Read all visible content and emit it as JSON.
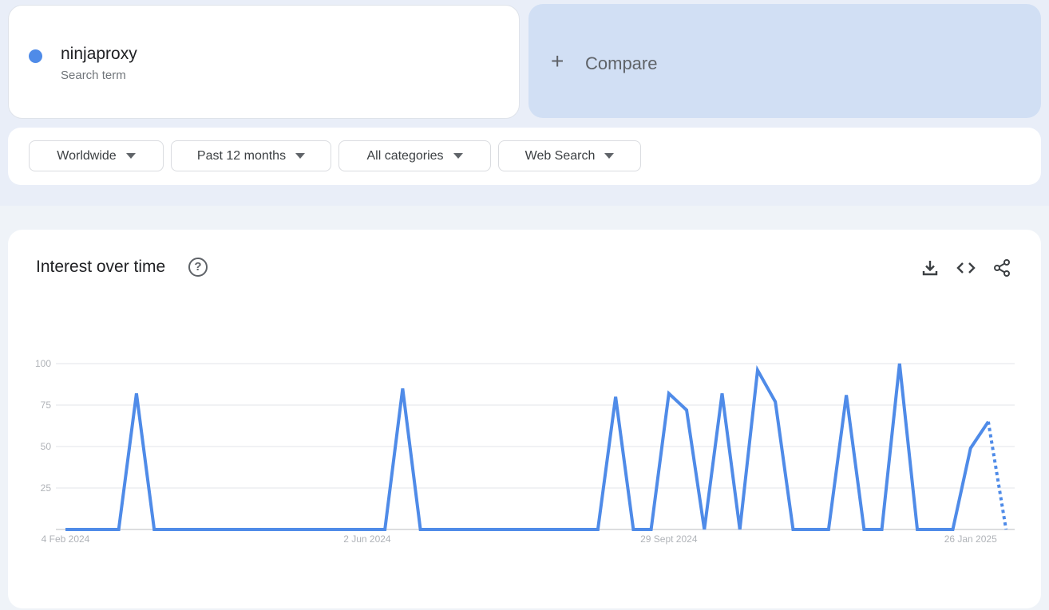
{
  "search_term": {
    "name": "ninjaproxy",
    "subtitle": "Search term",
    "color": "#4f8be8"
  },
  "compare": {
    "icon": "plus-icon",
    "plus": "+",
    "label": "Compare"
  },
  "filters": [
    {
      "label": "Worldwide"
    },
    {
      "label": "Past 12 months"
    },
    {
      "label": "All categories"
    },
    {
      "label": "Web Search"
    }
  ],
  "panel": {
    "title": "Interest over time",
    "help": "?",
    "actions": [
      "download-icon",
      "embed-code-icon",
      "share-icon"
    ]
  },
  "chart_data": {
    "type": "line",
    "title": "Interest over time",
    "xlabel": "",
    "ylabel": "",
    "ylim": [
      0,
      100
    ],
    "yticks": [
      25,
      50,
      75,
      100
    ],
    "grid": true,
    "x_tick_labels": [
      {
        "index": 0,
        "label": "4 Feb 2024"
      },
      {
        "index": 17,
        "label": "2 Jun 2024"
      },
      {
        "index": 34,
        "label": "29 Sept 2024"
      },
      {
        "index": 51,
        "label": "26 Jan 2025"
      }
    ],
    "series": [
      {
        "name": "ninjaproxy",
        "color": "#4f8be8",
        "values": [
          0,
          0,
          0,
          0,
          82,
          0,
          0,
          0,
          0,
          0,
          0,
          0,
          0,
          0,
          0,
          0,
          0,
          0,
          0,
          85,
          0,
          0,
          0,
          0,
          0,
          0,
          0,
          0,
          0,
          0,
          0,
          80,
          0,
          0,
          82,
          72,
          0,
          82,
          0,
          96,
          77,
          0,
          0,
          0,
          81,
          0,
          0,
          100,
          0,
          0,
          0,
          49,
          65,
          0
        ],
        "partial_from_index": 52
      }
    ]
  }
}
